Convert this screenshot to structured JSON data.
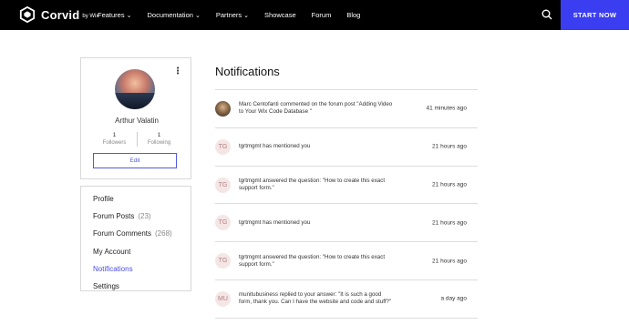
{
  "brand": {
    "name": "Corvid",
    "by": "by Wix"
  },
  "nav": [
    {
      "label": "Features",
      "dropdown": true
    },
    {
      "label": "Documentation",
      "dropdown": true
    },
    {
      "label": "Partners",
      "dropdown": true
    },
    {
      "label": "Showcase",
      "dropdown": false
    },
    {
      "label": "Forum",
      "dropdown": false
    },
    {
      "label": "Blog",
      "dropdown": false
    }
  ],
  "cta": "START NOW",
  "profile": {
    "name": "Arthur Valatin",
    "followers": {
      "count": "1",
      "label": "Followers"
    },
    "following": {
      "count": "1",
      "label": "Following"
    },
    "edit_label": "Edit"
  },
  "menu": [
    {
      "label": "Profile",
      "count": ""
    },
    {
      "label": "Forum Posts",
      "count": "(23)"
    },
    {
      "label": "Forum Comments",
      "count": "(268)"
    },
    {
      "label": "My Account",
      "count": ""
    },
    {
      "label": "Notifications",
      "count": "",
      "active": true
    },
    {
      "label": "Settings",
      "count": ""
    }
  ],
  "notifications_title": "Notifications",
  "notifications": [
    {
      "avatar": "",
      "text": "Marc Centofanti commented on the forum post \"Adding Video to Your Wix Code Database \"",
      "time": "41 minutes ago"
    },
    {
      "avatar": "TG",
      "text": "tgrtmgmt has mentioned you",
      "time": "21 hours ago"
    },
    {
      "avatar": "TG",
      "text": "tgrtmgmt answered the question: \"How to create this exact support form.\"",
      "time": "21 hours ago"
    },
    {
      "avatar": "TG",
      "text": "tgrtmgmt has mentioned you",
      "time": "21 hours ago"
    },
    {
      "avatar": "TG",
      "text": "tgrtmgmt answered the question: \"How to create this exact support form.\"",
      "time": "21 hours ago"
    },
    {
      "avatar": "MU",
      "text": "munitubusiness replied to your answer: \"It is such a good form, thank you. Can I have the website and code and stuff?\"",
      "time": "a day ago"
    }
  ]
}
